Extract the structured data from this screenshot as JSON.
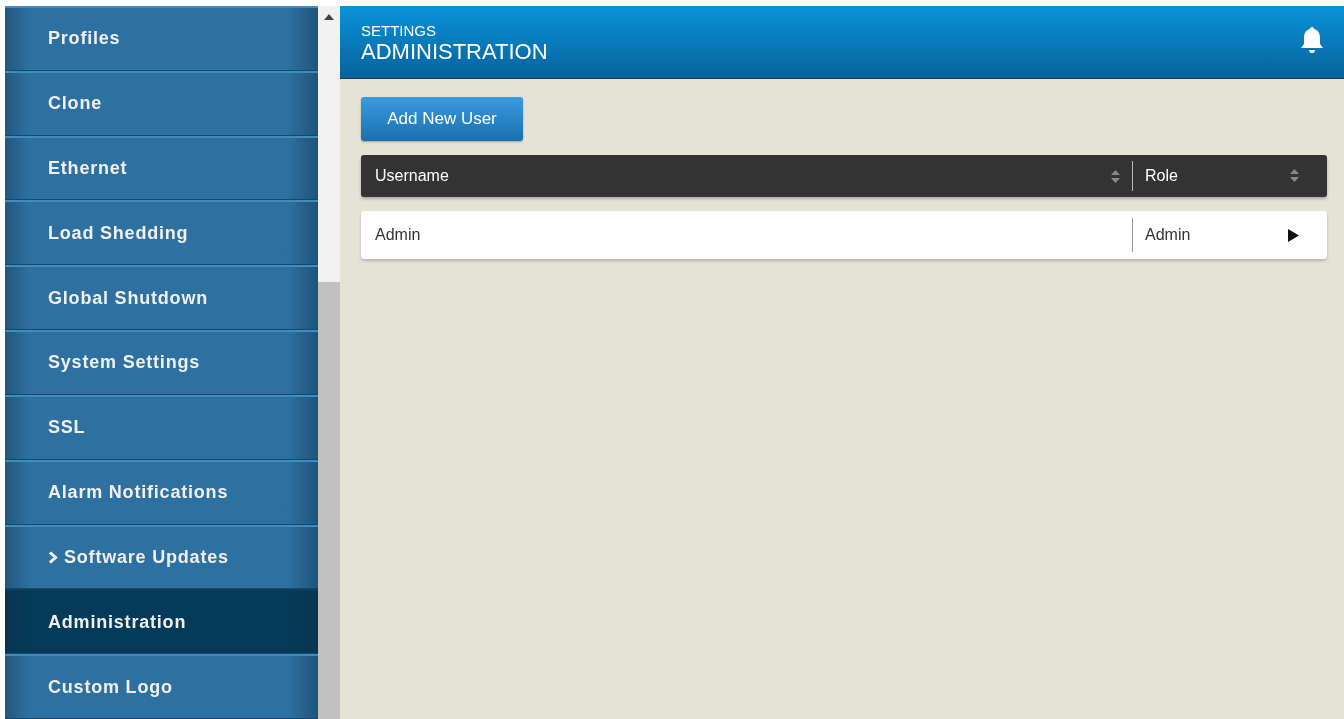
{
  "sidebar": {
    "items": [
      {
        "label": "Profiles",
        "kind": "link",
        "selected": false
      },
      {
        "label": "Clone",
        "kind": "link",
        "selected": false
      },
      {
        "label": "Ethernet",
        "kind": "link",
        "selected": false
      },
      {
        "label": "Load Shedding",
        "kind": "link",
        "selected": false
      },
      {
        "label": "Global Shutdown",
        "kind": "link",
        "selected": false
      },
      {
        "label": "System Settings",
        "kind": "link",
        "selected": false
      },
      {
        "label": "SSL",
        "kind": "link",
        "selected": false
      },
      {
        "label": "Alarm Notifications",
        "kind": "link",
        "selected": false
      },
      {
        "label": "Software Updates",
        "kind": "group",
        "selected": false
      },
      {
        "label": "Administration",
        "kind": "link",
        "selected": true
      },
      {
        "label": "Custom Logo",
        "kind": "link",
        "selected": false
      }
    ]
  },
  "header": {
    "section": "SETTINGS",
    "title": "ADMINISTRATION"
  },
  "add_button": "Add New User",
  "table": {
    "columns": [
      "Username",
      "Role"
    ],
    "rows": [
      {
        "cells": [
          "Admin",
          "Admin"
        ]
      }
    ]
  }
}
